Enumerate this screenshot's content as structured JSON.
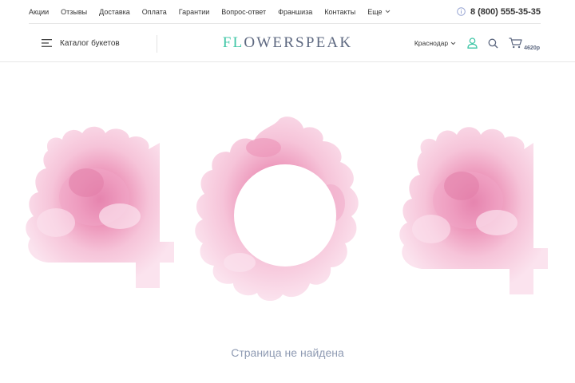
{
  "topnav": {
    "items": [
      "Акции",
      "Отзывы",
      "Доставка",
      "Оплата",
      "Гарантии",
      "Вопрос-ответ",
      "Франшиза",
      "Контакты"
    ],
    "more_label": "Еще"
  },
  "phone": {
    "number": "8 (800) 555-35-35",
    "icon": "info-icon"
  },
  "header": {
    "catalog_label": "Каталог букетов",
    "logo_accent": "FL",
    "logo_rest": "OWERSPEAK",
    "city_label": "Краснодар",
    "cart_price": "4620р"
  },
  "error_page": {
    "code_digits": [
      "4",
      "0",
      "4"
    ],
    "message": "Страница не найдена"
  },
  "colors": {
    "brand_accent": "#3fc6a6",
    "brand_text": "#5d6880",
    "peony_light": "#f6c6da",
    "peony_dark": "#e27ea8",
    "message": "#8f9bb3"
  }
}
